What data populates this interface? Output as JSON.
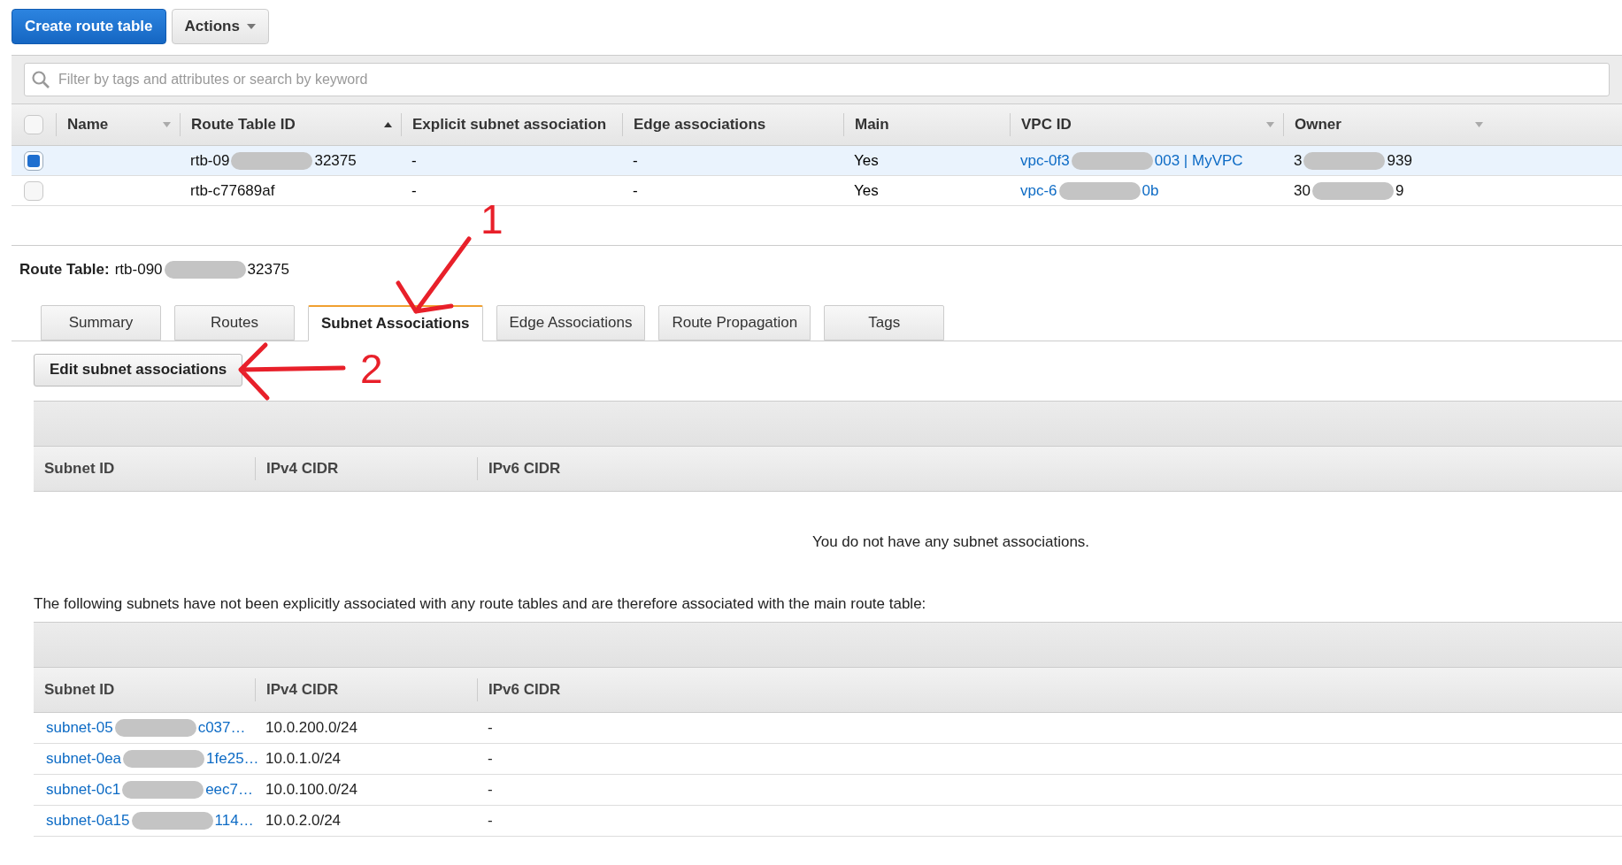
{
  "toolbar": {
    "create_button": "Create route table",
    "actions_button": "Actions"
  },
  "search": {
    "placeholder": "Filter by tags and attributes or search by keyword"
  },
  "table": {
    "select_all": {
      "checked": false
    },
    "columns": [
      {
        "label": "Name",
        "sorted": false,
        "has_menu": true
      },
      {
        "label": "Route Table ID",
        "sorted": true,
        "has_menu": false
      },
      {
        "label": "Explicit subnet association",
        "sorted": false,
        "has_menu": false
      },
      {
        "label": "Edge associations",
        "sorted": false,
        "has_menu": false
      },
      {
        "label": "Main",
        "sorted": false,
        "has_menu": false
      },
      {
        "label": "VPC ID",
        "sorted": false,
        "has_menu": true
      },
      {
        "label": "Owner",
        "sorted": false,
        "has_menu": true
      }
    ],
    "rows": [
      {
        "selected": true,
        "route_table_id": {
          "start": "rtb-09",
          "end": "32375"
        },
        "explicit": "-",
        "edge": "-",
        "main": "Yes",
        "vpc": {
          "start": "vpc-0f3",
          "end": "003 | MyVPC"
        },
        "owner": {
          "start": "3",
          "end": "939"
        }
      },
      {
        "selected": false,
        "route_table_id": {
          "start": "rtb-c77689af"
        },
        "explicit": "-",
        "edge": "-",
        "main": "Yes",
        "vpc": {
          "start": "vpc-6",
          "end": "0b"
        },
        "owner": {
          "start": "30",
          "end": "9"
        }
      }
    ]
  },
  "detail": {
    "label": "Route Table:",
    "id": {
      "start": "rtb-090",
      "end": "32375"
    },
    "tabs": [
      {
        "label": "Summary",
        "selected": false
      },
      {
        "label": "Routes",
        "selected": false
      },
      {
        "label": "Subnet Associations",
        "selected": true
      },
      {
        "label": "Edge Associations",
        "selected": false
      },
      {
        "label": "Route Propagation",
        "selected": false
      },
      {
        "label": "Tags",
        "selected": false
      }
    ],
    "edit_button": "Edit subnet associations",
    "associations": {
      "columns": [
        "Subnet ID",
        "IPv4 CIDR",
        "IPv6 CIDR"
      ],
      "empty_message": "You do not have any subnet associations."
    },
    "note": "The following subnets have not been explicitly associated with any route tables and are therefore associated with the main route table:",
    "main_subnets": {
      "columns": [
        "Subnet ID",
        "IPv4 CIDR",
        "IPv6 CIDR"
      ],
      "rows": [
        {
          "subnet": {
            "start": "subnet-05",
            "end": "c037…"
          },
          "ipv4": "10.0.200.0/24",
          "ipv6": "-"
        },
        {
          "subnet": {
            "start": "subnet-0ea",
            "end": "1fe25…"
          },
          "ipv4": "10.0.1.0/24",
          "ipv6": "-"
        },
        {
          "subnet": {
            "start": "subnet-0c1",
            "end": "eec7…"
          },
          "ipv4": "10.0.100.0/24",
          "ipv6": "-"
        },
        {
          "subnet": {
            "start": "subnet-0a15",
            "end": "114…"
          },
          "ipv4": "10.0.2.0/24",
          "ipv6": "-"
        }
      ]
    }
  },
  "annotations": [
    {
      "label": "1"
    },
    {
      "label": "2"
    }
  ]
}
